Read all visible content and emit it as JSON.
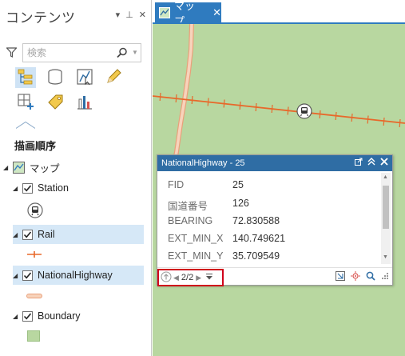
{
  "contents_pane": {
    "title": "コンテンツ",
    "header_buttons": {
      "options_glyph": "▾",
      "pin_glyph": "⊥",
      "close_glyph": "✕"
    },
    "search": {
      "placeholder": "検索",
      "value": ""
    },
    "drawing_order_title": "描画順序",
    "tools": [
      {
        "icon": "list-by-drawing-order-icon",
        "active": true
      },
      {
        "icon": "list-by-data-source-icon",
        "active": false
      },
      {
        "icon": "list-by-selection-icon",
        "active": false
      },
      {
        "icon": "list-by-editing-icon",
        "active": false
      },
      {
        "icon": "list-by-snapping-icon",
        "active": false
      },
      {
        "icon": "list-by-labeling-icon",
        "active": false
      },
      {
        "icon": "list-by-charts-icon",
        "active": false
      }
    ],
    "map_node": {
      "label": "マップ",
      "expanded": true
    },
    "layers": [
      {
        "label": "Station",
        "checked": true,
        "symbol": "station-symbol-icon"
      },
      {
        "label": "Rail",
        "checked": true,
        "highlighted": true,
        "symbol": "rail-line-symbol-icon"
      },
      {
        "label": "NationalHighway",
        "checked": true,
        "highlighted": true,
        "symbol": "highway-line-symbol-icon"
      },
      {
        "label": "Boundary",
        "checked": true,
        "symbol": "boundary-polygon-symbol-icon"
      }
    ]
  },
  "map_view": {
    "tab": {
      "label": "マップ",
      "close_glyph": "✕"
    }
  },
  "popup": {
    "title": "NationalHighway - 25",
    "fields": [
      {
        "name": "FID",
        "value": "25"
      },
      {
        "name": "国道番号",
        "value": "126"
      },
      {
        "name": "BEARING",
        "value": "72.830588"
      },
      {
        "name": "EXT_MIN_X",
        "value": "140.749621"
      },
      {
        "name": "EXT_MIN_Y",
        "value": "35.709549"
      }
    ],
    "navigation": {
      "counter": "2/2"
    }
  },
  "colors": {
    "accent_blue": "#2f7bbf",
    "popup_header": "#2f6da4",
    "map_background": "#b8d7a0",
    "rail_orange": "#e8682a",
    "highway_fill": "#f7d3bb",
    "highway_outline": "#e9a07a",
    "highlight_row": "#d6e8f7",
    "nav_outline_red": "#d0021b"
  }
}
